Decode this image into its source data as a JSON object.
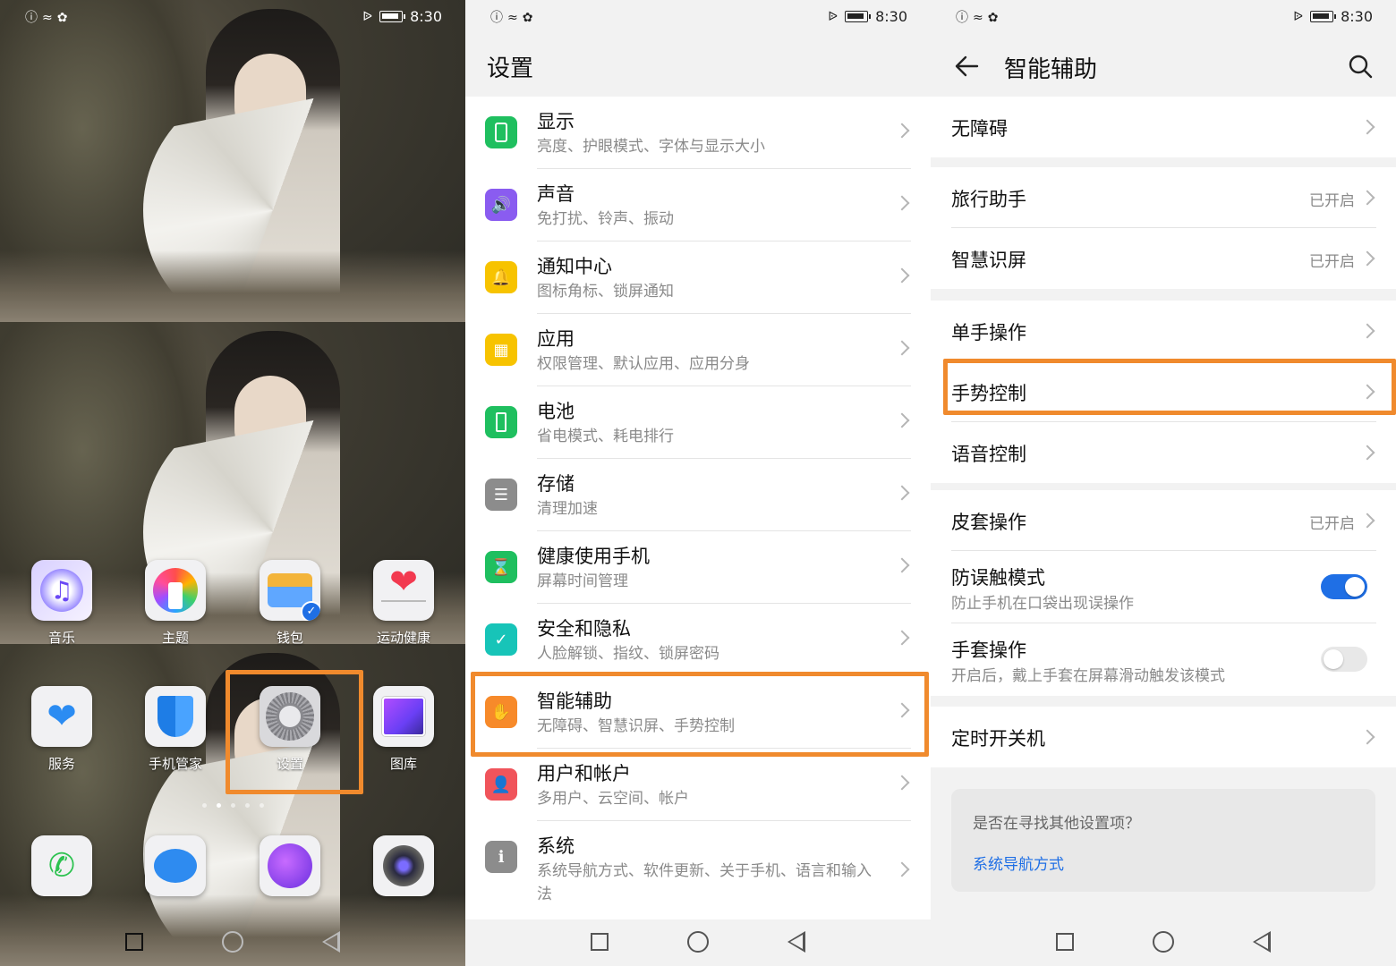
{
  "status_bar": {
    "time": "8:30"
  },
  "home": {
    "apps_row1": [
      {
        "label": "音乐",
        "icon": "music-icon"
      },
      {
        "label": "主题",
        "icon": "theme-brush-icon"
      },
      {
        "label": "钱包",
        "icon": "wallet-icon"
      },
      {
        "label": "运动健康",
        "icon": "heart-icon"
      }
    ],
    "apps_row2": [
      {
        "label": "服务",
        "icon": "service-heart-hand-icon"
      },
      {
        "label": "手机管家",
        "icon": "shield-icon"
      },
      {
        "label": "设置",
        "icon": "gear-icon"
      },
      {
        "label": "图库",
        "icon": "gallery-icon"
      }
    ],
    "dock": [
      {
        "icon": "phone-icon"
      },
      {
        "icon": "message-icon"
      },
      {
        "icon": "browser-icon"
      },
      {
        "icon": "camera-icon"
      }
    ],
    "page_count": 5,
    "active_page": 2
  },
  "settings": {
    "title": "设置",
    "items": [
      {
        "title": "显示",
        "sub": "亮度、护眼模式、字体与显示大小",
        "icon": "display-icon",
        "color": "#1fbf5f"
      },
      {
        "title": "声音",
        "sub": "免打扰、铃声、振动",
        "icon": "sound-icon",
        "color": "#8a5cf0"
      },
      {
        "title": "通知中心",
        "sub": "图标角标、锁屏通知",
        "icon": "bell-icon",
        "color": "#f7c300"
      },
      {
        "title": "应用",
        "sub": "权限管理、默认应用、应用分身",
        "icon": "apps-grid-icon",
        "color": "#f7c300"
      },
      {
        "title": "电池",
        "sub": "省电模式、耗电排行",
        "icon": "battery-icon",
        "color": "#1fbf5f"
      },
      {
        "title": "存储",
        "sub": "清理加速",
        "icon": "storage-icon",
        "color": "#8c8c8c"
      },
      {
        "title": "健康使用手机",
        "sub": "屏幕时间管理",
        "icon": "hourglass-icon",
        "color": "#1fbf5f"
      },
      {
        "title": "安全和隐私",
        "sub": "人脸解锁、指纹、锁屏密码",
        "icon": "security-shield-icon",
        "color": "#17c4b8"
      },
      {
        "title": "智能辅助",
        "sub": "无障碍、智慧识屏、手势控制",
        "icon": "hand-icon",
        "color": "#f78a2a"
      },
      {
        "title": "用户和帐户",
        "sub": "多用户、云空间、帐户",
        "icon": "user-icon",
        "color": "#f0545b"
      },
      {
        "title": "系统",
        "sub": "系统导航方式、软件更新、关于手机、语言和输入法",
        "icon": "system-info-icon",
        "color": "#8c8c8c"
      }
    ]
  },
  "assist": {
    "title": "智能辅助",
    "groups": [
      [
        {
          "label": "无障碍"
        }
      ],
      [
        {
          "label": "旅行助手",
          "status": "已开启"
        },
        {
          "label": "智慧识屏",
          "status": "已开启"
        }
      ],
      [
        {
          "label": "单手操作"
        },
        {
          "label": "手势控制"
        },
        {
          "label": "语音控制"
        }
      ],
      [
        {
          "label": "皮套操作",
          "status": "已开启"
        },
        {
          "label": "防误触模式",
          "sub": "防止手机在口袋出现误操作",
          "toggle": true
        },
        {
          "label": "手套操作",
          "sub": "开启后，戴上手套在屏幕滑动触发该模式",
          "toggle": false
        }
      ],
      [
        {
          "label": "定时开关机"
        }
      ]
    ],
    "hint": {
      "question": "是否在寻找其他设置项？",
      "link": "系统导航方式"
    }
  },
  "colors": {
    "highlight": "#f08a2d",
    "accent": "#1f6fe5"
  }
}
